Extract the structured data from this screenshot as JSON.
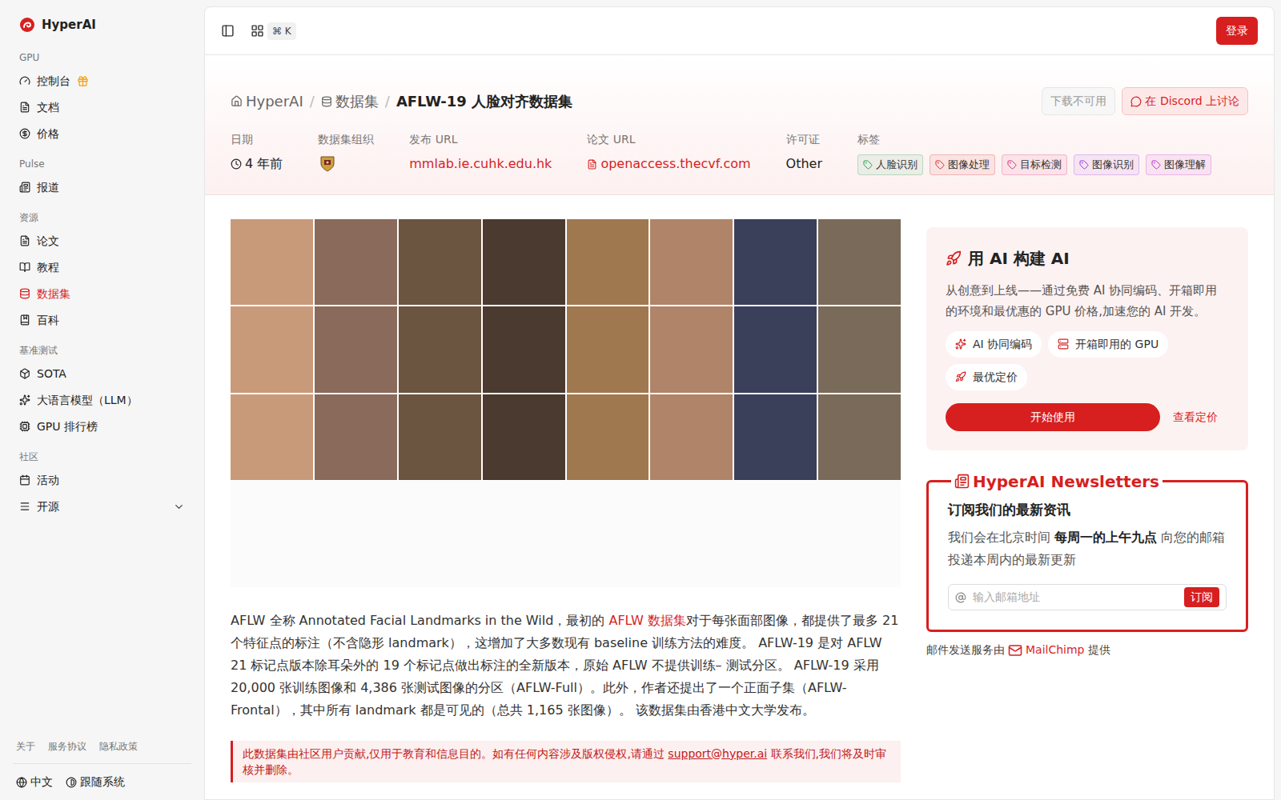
{
  "sidebar": {
    "logo": "HyperAI",
    "sections": [
      {
        "label": "GPU",
        "items": [
          {
            "label": "控制台",
            "selected": false,
            "badge": true,
            "expandable": false
          },
          {
            "label": "文档",
            "selected": false,
            "badge": false,
            "expandable": false
          },
          {
            "label": "价格",
            "selected": false,
            "badge": false,
            "expandable": false
          }
        ]
      },
      {
        "label": "Pulse",
        "items": [
          {
            "label": "报道",
            "selected": false,
            "badge": false,
            "expandable": false
          }
        ]
      },
      {
        "label": "资源",
        "items": [
          {
            "label": "论文",
            "selected": false,
            "badge": false,
            "expandable": false
          },
          {
            "label": "教程",
            "selected": false,
            "badge": false,
            "expandable": false
          },
          {
            "label": "数据集",
            "selected": true,
            "badge": false,
            "expandable": false
          },
          {
            "label": "百科",
            "selected": false,
            "badge": false,
            "expandable": false
          }
        ]
      },
      {
        "label": "基准测试",
        "items": [
          {
            "label": "SOTA",
            "selected": false,
            "badge": false,
            "expandable": false
          },
          {
            "label": "大语言模型（LLM）",
            "selected": false,
            "badge": false,
            "expandable": false
          },
          {
            "label": "GPU 排行榜",
            "selected": false,
            "badge": false,
            "expandable": false
          }
        ]
      },
      {
        "label": "社区",
        "items": [
          {
            "label": "活动",
            "selected": false,
            "badge": false,
            "expandable": false
          },
          {
            "label": "开源",
            "selected": false,
            "badge": false,
            "expandable": true
          }
        ]
      }
    ],
    "footer_links": [
      "关于",
      "服务协议",
      "隐私政策"
    ],
    "language": "中文",
    "theme": "跟随系统"
  },
  "header": {
    "shortcut": "⌘ K",
    "login": "登录"
  },
  "breadcrumb": {
    "separator": "/",
    "items": [
      "HyperAI",
      "数据集",
      "AFLW-19 人脸对齐数据集"
    ]
  },
  "actions": [
    {
      "label": "下载不可用",
      "disabled": true
    },
    {
      "label": "在 Discord 上讨论",
      "disabled": false
    }
  ],
  "meta": [
    {
      "label": "日期",
      "value": "4 年前",
      "kind": "time"
    },
    {
      "label": "数据集组织",
      "value": "",
      "kind": "logo"
    },
    {
      "label": "发布 URL",
      "value": "mmlab.ie.cuhk.edu.hk",
      "kind": "link"
    },
    {
      "label": "论文 URL",
      "value": "openaccess.thecvf.com",
      "kind": "paper"
    },
    {
      "label": "许可证",
      "value": "Other",
      "kind": "text"
    }
  ],
  "tags": {
    "label": "标签",
    "items": [
      {
        "label": "人脸识别",
        "color": "#16a34a"
      },
      {
        "label": "图像处理",
        "color": "#dc2626"
      },
      {
        "label": "目标检测",
        "color": "#db2777"
      },
      {
        "label": "图像识别",
        "color": "#9333ea"
      },
      {
        "label": "图像理解",
        "color": "#c026d3"
      }
    ]
  },
  "description": {
    "segments": [
      {
        "text": "AFLW 全称 Annotated Facial Landmarks in the Wild，最初的 ",
        "link": false
      },
      {
        "text": "AFLW 数据集",
        "link": true
      },
      {
        "text": "对于每张面部图像，都提供了最多 21 个特征点的标注（不含隐形 landmark），这增加了大多数现有 baseline 训练方法的难度。 AFLW-19 是对 AFLW 21 标记点版本除耳朵外的 19 个标记点做出标注的全新版本，原始 AFLW 不提供训练– 测试分区。 AFLW-19 采用 20,000 张训练图像和 4,386 张测试图像的分区（AFLW-Full）。此外，作者还提出了一个正面子集（AFLW-Frontal），其中所有 landmark 都是可见的（总共 1,165 张图像）。 该数据集由香港中文大学发布。",
        "link": false
      }
    ]
  },
  "disclaimer": {
    "segments": [
      {
        "text": "此数据集由社区用户贡献,仅用于教育和信息目的。如有任何内容涉及版权侵权,请通过 ",
        "link": false
      },
      {
        "text": "support@hyper.ai",
        "link": true
      },
      {
        "text": " 联系我们,我们将及时审核并删除。",
        "link": false
      }
    ]
  },
  "promo": {
    "title": "用 AI 构建 AI",
    "text": "从创意到上线——通过免费 AI 协同编码、开箱即用的环境和最优惠的 GPU 价格,加速您的 AI 开发。",
    "chips": [
      "AI 协同编码",
      "开箱即用的 GPU",
      "最优定价"
    ],
    "primary": "开始使用",
    "secondary": "查看定价"
  },
  "newsletter": {
    "title": "HyperAI Newsletters",
    "heading": "订阅我们的最新资讯",
    "text_before": "我们会在北京时间 ",
    "text_bold": "每周一的上午九点",
    "text_after": " 向您的邮箱投递本周内的最新更新",
    "placeholder": "输入邮箱地址",
    "button": "订阅",
    "footer_before": "邮件发送服务由",
    "footer_link": "MailChimp",
    "footer_after": "提供"
  }
}
